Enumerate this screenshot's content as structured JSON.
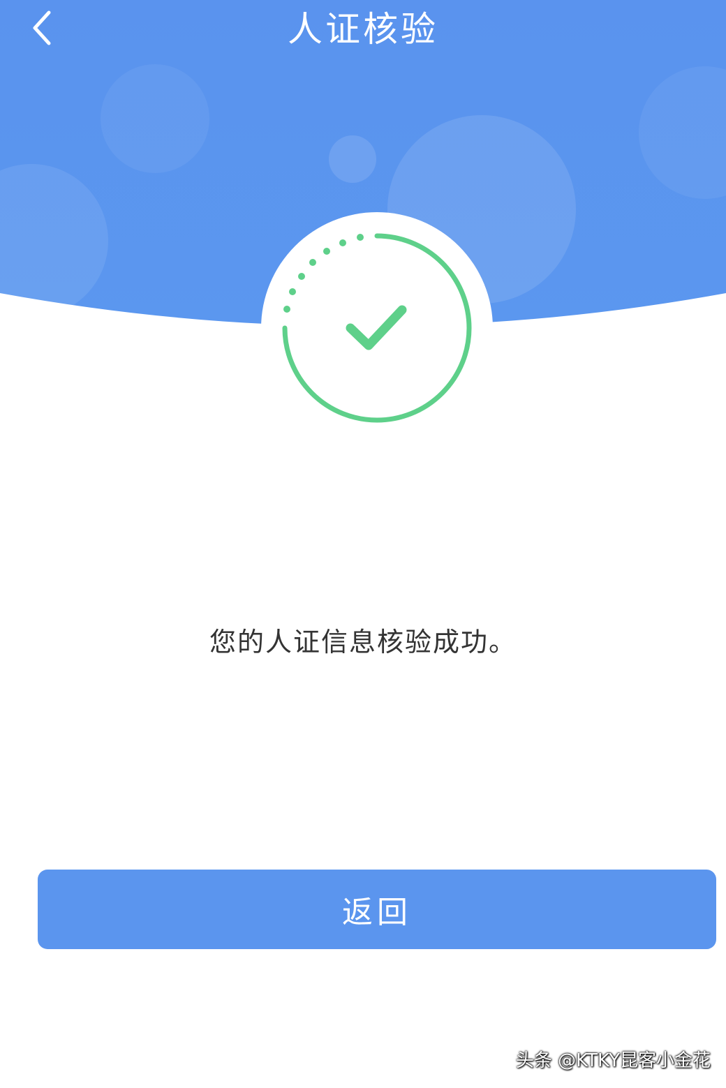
{
  "header": {
    "title": "人证核验",
    "back_icon": "chevron-left-icon"
  },
  "status": {
    "icon": "checkmark-circle-icon",
    "message": "您的人证信息核验成功。"
  },
  "actions": {
    "return_label": "返回"
  },
  "watermark": {
    "text": "头条 @KTKY昆客小金花"
  },
  "colors": {
    "header_blue": "#5b95ee",
    "accent_green": "#5ed08a",
    "button_blue": "#5b95ee",
    "background": "#ffffff"
  }
}
